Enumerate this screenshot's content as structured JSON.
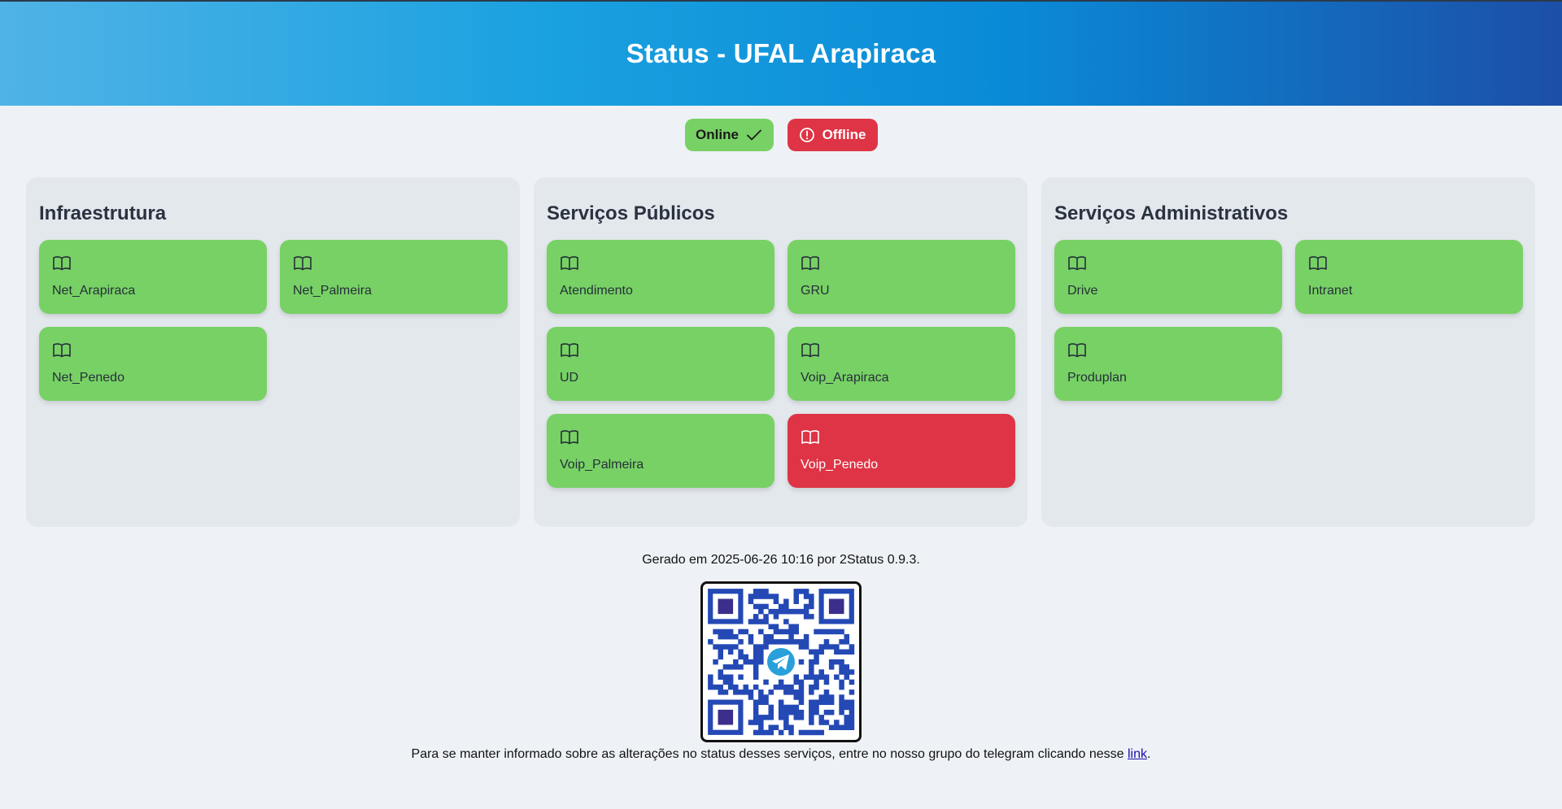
{
  "header": {
    "title": "Status - UFAL Arapiraca"
  },
  "legend": {
    "online_label": "Online",
    "offline_label": "Offline",
    "online_color": "#78d165",
    "offline_color": "#de3445"
  },
  "groups": [
    {
      "title": "Infraestrutura",
      "services": [
        {
          "name": "Net_Arapiraca",
          "status": "online",
          "icon": "book-open-icon"
        },
        {
          "name": "Net_Palmeira",
          "status": "online",
          "icon": "book-open-icon"
        },
        {
          "name": "Net_Penedo",
          "status": "online",
          "icon": "book-open-icon"
        }
      ]
    },
    {
      "title": "Serviços Públicos",
      "services": [
        {
          "name": "Atendimento",
          "status": "online",
          "icon": "book-open-icon"
        },
        {
          "name": "GRU",
          "status": "online",
          "icon": "book-open-icon"
        },
        {
          "name": "UD",
          "status": "online",
          "icon": "book-open-icon"
        },
        {
          "name": "Voip_Arapiraca",
          "status": "online",
          "icon": "book-open-icon"
        },
        {
          "name": "Voip_Palmeira",
          "status": "online",
          "icon": "book-open-icon"
        },
        {
          "name": "Voip_Penedo",
          "status": "offline",
          "icon": "book-open-icon"
        }
      ]
    },
    {
      "title": "Serviços Administrativos",
      "services": [
        {
          "name": "Drive",
          "status": "online",
          "icon": "book-open-icon"
        },
        {
          "name": "Intranet",
          "status": "online",
          "icon": "book-open-icon"
        },
        {
          "name": "Produplan",
          "status": "online",
          "icon": "book-open-icon"
        }
      ]
    }
  ],
  "footer": {
    "generated_text": "Gerado em 2025-06-26 10:16 por 2Status 0.9.3.",
    "telegram_text": "Para se manter informado sobre as alterações no status desses serviços, entre no nosso grupo do telegram clicando nesse",
    "link_label": "link",
    "telegram_suffix": "."
  }
}
